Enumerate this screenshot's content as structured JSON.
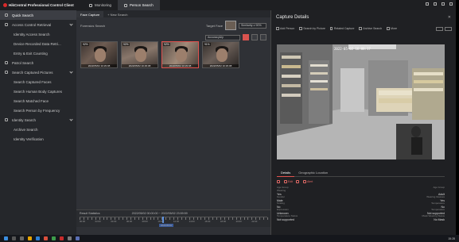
{
  "app": {
    "title": "HikCentral Professional Control Client",
    "top_tabs": [
      {
        "label": "Monitoring",
        "icon": "monitor-icon"
      },
      {
        "label": "Person Search",
        "icon": "person-search-icon"
      }
    ]
  },
  "sidebar": {
    "items": [
      {
        "label": "Quick Search",
        "type": "group",
        "icon": "search-icon"
      },
      {
        "label": "Access Control Retrieval",
        "type": "group",
        "icon": "door-icon"
      },
      {
        "label": "Identity Access Search",
        "type": "sub"
      },
      {
        "label": "Device Recorded Data Retri...",
        "type": "sub"
      },
      {
        "label": "Entry & Exit Counting",
        "type": "sub"
      },
      {
        "label": "Patrol Search",
        "type": "group",
        "icon": "patrol-icon"
      },
      {
        "label": "Search Captured Pictures",
        "type": "group",
        "icon": "picture-icon"
      },
      {
        "label": "Search Captured Faces",
        "type": "sub"
      },
      {
        "label": "Search Human Body Captures",
        "type": "sub"
      },
      {
        "label": "Search Matched Face",
        "type": "sub"
      },
      {
        "label": "Search Person by Frequency",
        "type": "sub"
      },
      {
        "label": "Identity Search",
        "type": "group",
        "icon": "id-card-icon"
      },
      {
        "label": "Archive Search",
        "type": "sub"
      },
      {
        "label": "Identity Verification",
        "type": "sub"
      }
    ]
  },
  "content": {
    "tabs": [
      {
        "label": "Face Capture"
      },
      {
        "label": "+  New Search"
      }
    ],
    "result_label": "Forensics Search",
    "target_face_label": "Target Face",
    "similarity_value": "Similarity ≥ 90%",
    "sort_value": "Accuracy&ly",
    "thumbnails": [
      {
        "score": "92%",
        "time": "2022/05/02 10:29:08"
      },
      {
        "score": "92%",
        "time": "2022/05/02 10:29:08"
      },
      {
        "score": "92%",
        "time": "2022/05/02 10:29:08"
      },
      {
        "score": "91%",
        "time": "2022/05/02 10:29:08"
      }
    ],
    "stats": {
      "label": "Result Statistics",
      "range": "2022/05/02 00:00:00 ~ 2022/05/02 23:59:59",
      "timeline_labels": [
        "00:00",
        "02:00",
        "04:00",
        "06:00",
        "08:00",
        "10:00",
        "12:00",
        "14:00",
        "16:00",
        "18:00",
        "20:00",
        "22:00"
      ],
      "timeline_date": "2022/05/02",
      "marker_fraction": 0.44
    }
  },
  "details": {
    "title": "Capture Details",
    "toolbar": [
      {
        "label": "Add Person",
        "icon": "add-person-icon"
      },
      {
        "label": "Search by Picture",
        "icon": "image-search-icon"
      },
      {
        "label": "Related Capture",
        "icon": "link-icon"
      },
      {
        "label": "Archive Search",
        "icon": "archive-icon"
      },
      {
        "label": "More",
        "icon": "more-icon"
      }
    ],
    "video_osd": "2022-05-02  16:08:17",
    "tabs": [
      {
        "label": "Details"
      },
      {
        "label": "Geographic Location"
      }
    ],
    "actions": [
      {
        "label": "",
        "icon": "edit-icon"
      },
      {
        "label": "Edit",
        "icon": "pencil-icon"
      },
      {
        "label": "",
        "icon": "download-icon"
      },
      {
        "label": "Alert",
        "icon": "alert-icon"
      }
    ],
    "attributes_left": [
      {
        "value": "Age Group",
        "key": "Wearing"
      },
      {
        "value": "Yes",
        "key": "Gender"
      },
      {
        "value": "Male",
        "key": "Smiling"
      },
      {
        "value": "No",
        "key": "Expression"
      },
      {
        "value": "Unknown",
        "key": "Temperature Status"
      },
      {
        "value": "Not supported",
        "key": ""
      }
    ],
    "attributes_right": [
      {
        "value": "Age Group",
        "key": ""
      },
      {
        "value": "Adult",
        "key": "Wearing Glasses"
      },
      {
        "value": "Yes",
        "key": "Temperature"
      },
      {
        "value": "No",
        "key": "Temperature"
      },
      {
        "value": "Not supported",
        "key": "Mask Wearing Status"
      },
      {
        "value": "No Mask",
        "key": ""
      }
    ]
  },
  "taskbar": {
    "clock": "15:28"
  }
}
